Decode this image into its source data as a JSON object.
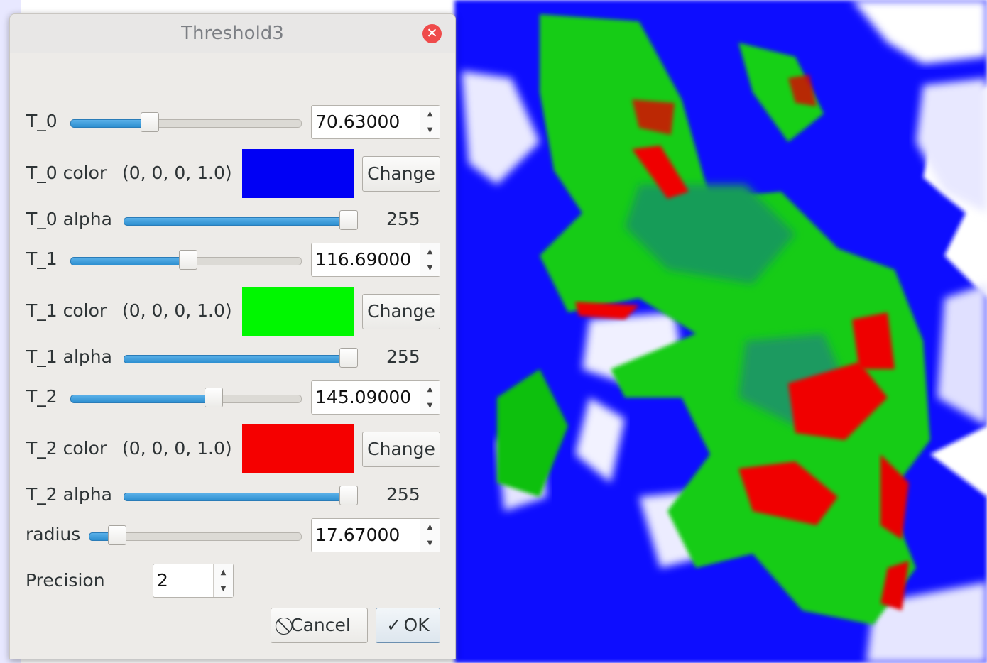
{
  "dialog": {
    "title": "Threshold3",
    "close_icon": "close-icon"
  },
  "thresholds": [
    {
      "label": "T_0",
      "value": "70.63000",
      "slider_fraction": 0.33,
      "color_label": "T_0 color",
      "color_value": "(0, 0, 0, 1.0)",
      "swatch": "#0000f5",
      "alpha_label": "T_0 alpha",
      "alpha_value": "255",
      "alpha_fraction": 1.0,
      "change_label": "Change"
    },
    {
      "label": "T_1",
      "value": "116.69000",
      "slider_fraction": 0.51,
      "color_label": "T_1 color",
      "color_value": "(0, 0, 0, 1.0)",
      "swatch": "#00f700",
      "alpha_label": "T_1 alpha",
      "alpha_value": "255",
      "alpha_fraction": 1.0,
      "change_label": "Change"
    },
    {
      "label": "T_2",
      "value": "145.09000",
      "slider_fraction": 0.63,
      "color_label": "T_2 color",
      "color_value": "(0, 0, 0, 1.0)",
      "swatch": "#f50000",
      "alpha_label": "T_2 alpha",
      "alpha_value": "255",
      "alpha_fraction": 1.0,
      "change_label": "Change"
    }
  ],
  "radius": {
    "label": "radius",
    "value": "17.67000",
    "slider_fraction": 0.1
  },
  "precision": {
    "label": "Precision",
    "value": "2"
  },
  "buttons": {
    "cancel_label": "Cancel",
    "cancel_icon": "cancel-icon",
    "ok_label": "OK",
    "ok_icon": "checkmark-icon"
  },
  "colors": {
    "map_low": "#0000ff",
    "map_mid": "#00e000",
    "map_high": "#ff0000"
  }
}
